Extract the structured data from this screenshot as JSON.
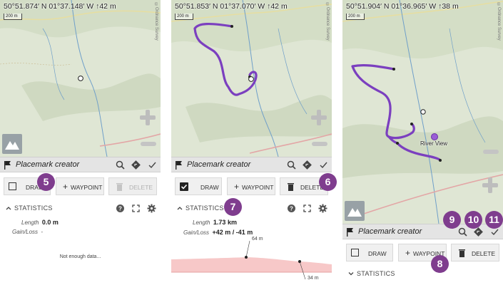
{
  "screens": [
    {
      "coords": "50°51.874′ N 01°37.148′ W",
      "altitude": "↑42 m",
      "scale": "200 m",
      "attribution": "©Ordnance Survey",
      "toolbar_title": "Placemark creator",
      "buttons": {
        "draw": "DRAW",
        "waypoint": "WAYPOINT",
        "delete": "DELETE"
      },
      "draw_checked": false,
      "delete_enabled": false,
      "statistics_label": "STATISTICS",
      "length_label": "Length",
      "length_value": "0.0 m",
      "gainloss_label": "Gain/Loss",
      "gainloss_value": "-",
      "no_data": "Not enough data..."
    },
    {
      "coords": "50°51.853′ N 01°37.070′ W",
      "altitude": "↑42 m",
      "scale": "200 m",
      "attribution": "©Ordnance Survey",
      "toolbar_title": "Placemark creator",
      "buttons": {
        "draw": "DRAW",
        "waypoint": "WAYPOINT",
        "delete": "DELETE"
      },
      "draw_checked": true,
      "delete_enabled": true,
      "statistics_label": "STATISTICS",
      "length_label": "Length",
      "length_value": "1.73 km",
      "gainloss_label": "Gain/Loss",
      "gainloss_value": "+42 m / -41 m",
      "elevation_max": "64 m",
      "elevation_min": "34 m"
    },
    {
      "coords": "50°51.904′ N 01°36.965′ W",
      "altitude": "↑38 m",
      "scale": "200 m",
      "attribution": "©Ordnance Survey",
      "toolbar_title": "Placemark creator",
      "buttons": {
        "draw": "DRAW",
        "waypoint": "WAYPOINT",
        "delete": "DELETE"
      },
      "draw_checked": false,
      "delete_enabled": true,
      "statistics_label": "STATISTICS",
      "waypoint_label": "River View"
    }
  ],
  "callouts": [
    "5",
    "6",
    "7",
    "8",
    "9",
    "10",
    "11"
  ],
  "colors": {
    "track": "#7b3fbf",
    "callout": "#7f3d8e",
    "toolbar": "#e4e4e4",
    "map_base": "#dfe6d4",
    "chart_fill": "#f7c8c8"
  },
  "icons": [
    "flag-icon",
    "search-icon",
    "route-icon",
    "check-icon",
    "checkbox-icon",
    "plus-icon",
    "trash-icon",
    "help-icon",
    "fullscreen-icon",
    "gear-icon",
    "chevron-up-icon",
    "chevron-down-icon",
    "zoom-in-icon",
    "zoom-out-icon",
    "app-logo-icon",
    "location-dot-icon",
    "waypoint-icon"
  ]
}
